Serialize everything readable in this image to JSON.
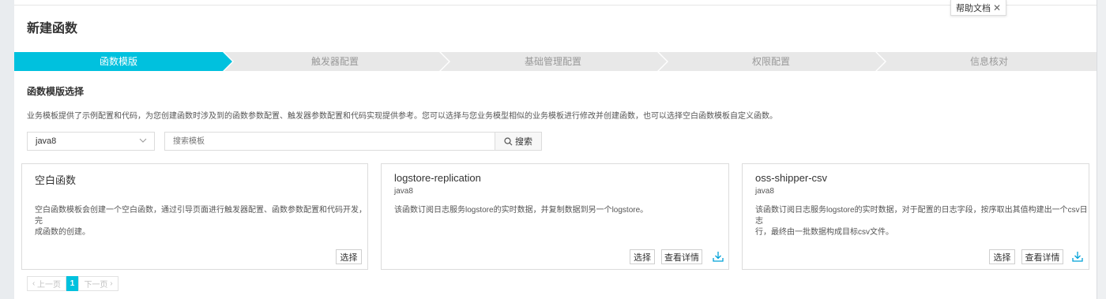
{
  "help": {
    "label": "帮助文档",
    "close_symbol": "✕"
  },
  "page": {
    "title": "新建函数"
  },
  "steps": [
    {
      "label": "函数模版",
      "active": true
    },
    {
      "label": "触发器配置",
      "active": false
    },
    {
      "label": "基础管理配置",
      "active": false
    },
    {
      "label": "权限配置",
      "active": false
    },
    {
      "label": "信息核对",
      "active": false
    }
  ],
  "colors": {
    "accent": "#00c1de",
    "step_inactive": "#e8e8e8",
    "step_divider": "#ffffff"
  },
  "section": {
    "title": "函数模版选择",
    "description": "业务模板提供了示例配置和代码，为您创建函数时涉及到的函数参数配置、触发器参数配置和代码实现提供参考。您可以选择与您业务模型相似的业务模板进行修改并创建函数，也可以选择空白函数模板自定义函数。"
  },
  "filter": {
    "runtime_value": "java8",
    "search_placeholder": "搜索模板",
    "search_button": "搜索"
  },
  "cards": [
    {
      "name": "空白函数",
      "runtime": "",
      "line1": "空白函数模板会创建一个空白函数，通过引导页面进行触发器配置、函数参数配置和代码开发，完",
      "line2": "成函数的创建。",
      "select_label": "选择",
      "details_label": ""
    },
    {
      "name": "logstore-replication",
      "runtime": "java8",
      "line1": "该函数订阅日志服务logstore的实时数据，并复制数据到另一个logstore。",
      "line2": "",
      "select_label": "选择",
      "details_label": "查看详情"
    },
    {
      "name": "oss-shipper-csv",
      "runtime": "java8",
      "line1": "该函数订阅日志服务logstore的实时数据，对于配置的日志字段，按序取出其值构建出一个csv日志",
      "line2": "行，最终由一批数据构成目标csv文件。",
      "select_label": "选择",
      "details_label": "查看详情"
    }
  ],
  "pagination": {
    "prev": "上一页",
    "current": "1",
    "next": "下一页"
  },
  "icons": {
    "search": "search-icon",
    "download": "download-icon",
    "chevron": "chevron-down-icon"
  }
}
